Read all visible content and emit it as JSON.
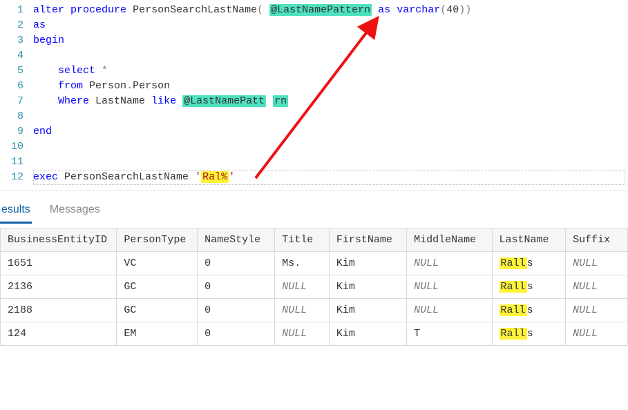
{
  "editor": {
    "lines": {
      "l1_alter": "alter",
      "l1_proc": "procedure",
      "l1_name": "PersonSearchLastName",
      "l1_paren_open": "(",
      "l1_param_at": "@LastNamePattern",
      "l1_as": "as",
      "l1_type": "varchar",
      "l1_paren2_open": "(",
      "l1_size": "40",
      "l1_paren2_close": ")",
      "l1_paren_close": ")",
      "l2_as": "as",
      "l3_begin": "begin",
      "l5_select": "select",
      "l5_star": "*",
      "l6_from": "from",
      "l6_obj": "Person",
      "l6_dot": ".",
      "l6_obj2": "Person",
      "l7_where": "Where",
      "l7_col": "LastName",
      "l7_like": "like",
      "l7_param_a": "@LastNamePatt",
      "l7_param_b": "rn",
      "l9_end": "end",
      "l12_exec": "exec",
      "l12_proc": "PersonSearchLastName",
      "l12_q1": "'",
      "l12_arg": "Ral%",
      "l12_q2": "'"
    },
    "line_numbers": [
      "1",
      "2",
      "3",
      "4",
      "5",
      "6",
      "7",
      "8",
      "9",
      "10",
      "11",
      "12"
    ]
  },
  "tabs": {
    "results": "esults",
    "messages": "Messages"
  },
  "results": {
    "headers": {
      "be": "BusinessEntityID",
      "pt": "PersonType",
      "ns": "NameStyle",
      "ti": "Title",
      "fn": "FirstName",
      "mn": "MiddleName",
      "ln": "LastName",
      "sf": "Suffix"
    },
    "null_text": "NULL",
    "rows": [
      {
        "be": "1651",
        "pt": "VC",
        "ns": "0",
        "ti": "Ms.",
        "fn": "Kim",
        "mn": null,
        "ln_hl": "Rall",
        "ln_tail": "s",
        "sf": null
      },
      {
        "be": "2136",
        "pt": "GC",
        "ns": "0",
        "ti": null,
        "fn": "Kim",
        "mn": null,
        "ln_hl": "Rall",
        "ln_tail": "s",
        "sf": null
      },
      {
        "be": "2188",
        "pt": "GC",
        "ns": "0",
        "ti": null,
        "fn": "Kim",
        "mn": null,
        "ln_hl": "Rall",
        "ln_tail": "s",
        "sf": null
      },
      {
        "be": "124",
        "pt": "EM",
        "ns": "0",
        "ti": null,
        "fn": "Kim",
        "mn": "T",
        "ln_hl": "Rall",
        "ln_tail": "s",
        "sf": null
      }
    ]
  }
}
